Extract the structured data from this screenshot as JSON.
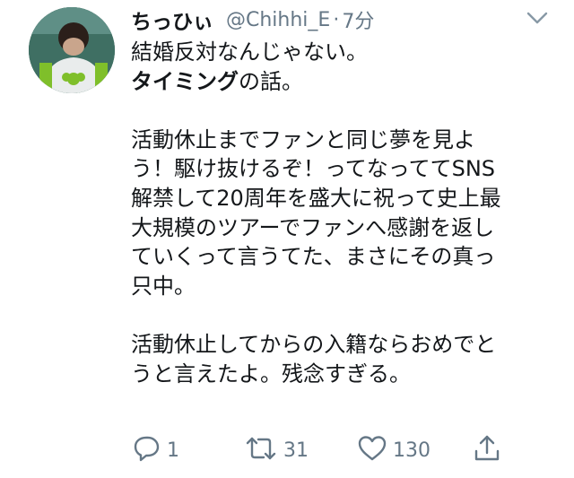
{
  "tweet": {
    "display_name": "ちっひぃ",
    "handle": "@Chihhi_E",
    "separator": "·",
    "timestamp": "7分",
    "lines": [
      {
        "text": "結婚反対なんじゃない。"
      },
      {
        "bold": "タイミング",
        "rest": "の話。"
      },
      {
        "blank": true
      },
      {
        "text": "活動休止までファンと同じ夢を見よ"
      },
      {
        "text": "う！駆け抜けるぞ！ってなっててSNS"
      },
      {
        "text": "解禁して20周年を盛大に祝って史上最"
      },
      {
        "text": "大規模のツアーでファンへ感謝を返し"
      },
      {
        "text": "ていくって言うてた、まさにその真っ"
      },
      {
        "text": "只中。"
      },
      {
        "blank": true
      },
      {
        "text": "活動休止してからの入籍ならおめでと"
      },
      {
        "text": "うと言えたよ。残念すぎる。"
      }
    ]
  },
  "actions": {
    "reply_count": "1",
    "retweet_count": "31",
    "like_count": "130"
  },
  "colors": {
    "text": "#14171a",
    "secondary": "#657786",
    "background": "#ffffff"
  },
  "icons": {
    "caret": "chevron-down-icon",
    "reply": "reply-icon",
    "retweet": "retweet-icon",
    "like": "heart-icon",
    "share": "share-icon"
  }
}
